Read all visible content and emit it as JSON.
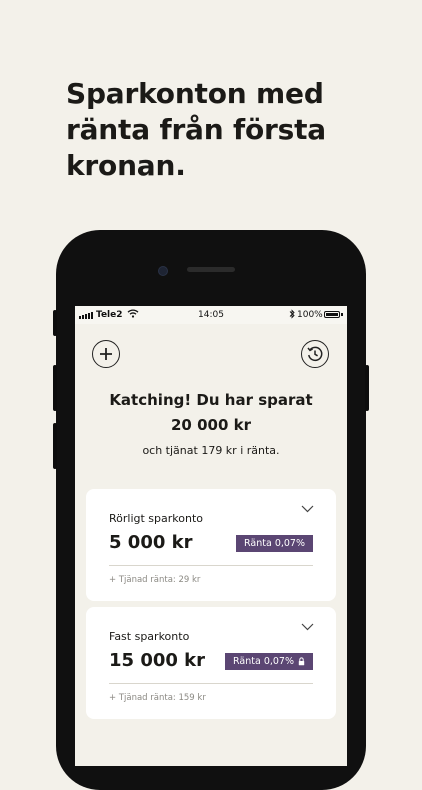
{
  "headline": "Sparkonton med ränta från första kronan.",
  "status_bar": {
    "carrier": "Tele2",
    "time": "14:05",
    "battery": "100%"
  },
  "summary": {
    "title": "Katching! Du har sparat",
    "amount": "20 000 kr",
    "interest": "och tjänat 179 kr i ränta."
  },
  "accounts": [
    {
      "name": "Rörligt sparkonto",
      "amount": "5 000 kr",
      "rate": "Ränta 0,07%",
      "earned": "+ Tjänad ränta: 29 kr",
      "locked": false
    },
    {
      "name": "Fast sparkonto",
      "amount": "15 000 kr",
      "rate": "Ränta 0,07%",
      "earned": "+ Tjänad ränta: 159 kr",
      "locked": true
    }
  ],
  "icons": {
    "add": "plus-icon",
    "history": "history-clock-icon",
    "expand": "chevron-down-icon",
    "lock": "lock-icon"
  },
  "colors": {
    "background": "#f3f1ea",
    "badge": "#5b4673",
    "phone_frame": "#101010"
  }
}
